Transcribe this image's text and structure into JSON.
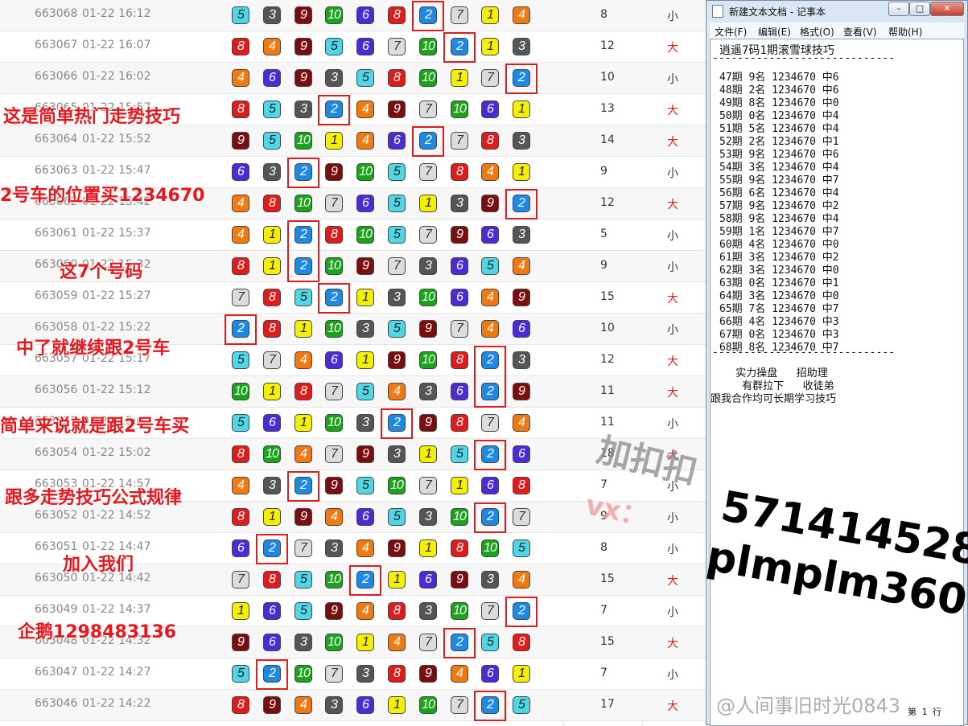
{
  "rows": [
    {
      "issue": "663068",
      "time": "01-22 16:12",
      "balls": [
        5,
        3,
        9,
        10,
        6,
        8,
        2,
        7,
        1,
        4
      ],
      "sum": "8",
      "bs": "小"
    },
    {
      "issue": "663067",
      "time": "01-22 16:07",
      "balls": [
        8,
        4,
        9,
        5,
        6,
        7,
        10,
        2,
        1,
        3
      ],
      "sum": "12",
      "bs": "大"
    },
    {
      "issue": "663066",
      "time": "01-22 16:02",
      "balls": [
        4,
        6,
        9,
        3,
        5,
        8,
        10,
        1,
        7,
        2
      ],
      "sum": "10",
      "bs": "小"
    },
    {
      "issue": "663065",
      "time": "01-22 15:57",
      "balls": [
        8,
        5,
        3,
        2,
        4,
        9,
        7,
        10,
        6,
        1
      ],
      "sum": "13",
      "bs": "大"
    },
    {
      "issue": "663064",
      "time": "01-22 15:52",
      "balls": [
        9,
        5,
        10,
        1,
        4,
        6,
        2,
        7,
        8,
        3
      ],
      "sum": "14",
      "bs": "大"
    },
    {
      "issue": "663063",
      "time": "01-22 15:47",
      "balls": [
        6,
        3,
        2,
        9,
        10,
        5,
        7,
        8,
        4,
        1
      ],
      "sum": "9",
      "bs": "小"
    },
    {
      "issue": "663062",
      "time": "01-22 15:42",
      "balls": [
        4,
        8,
        10,
        7,
        6,
        5,
        1,
        3,
        9,
        2
      ],
      "sum": "12",
      "bs": "大"
    },
    {
      "issue": "663061",
      "time": "01-22 15:37",
      "balls": [
        4,
        1,
        2,
        8,
        10,
        5,
        7,
        9,
        6,
        3
      ],
      "sum": "5",
      "bs": "小"
    },
    {
      "issue": "663060",
      "time": "01-22 15:32",
      "balls": [
        8,
        1,
        2,
        10,
        9,
        7,
        3,
        6,
        5,
        4
      ],
      "sum": "9",
      "bs": "小"
    },
    {
      "issue": "663059",
      "time": "01-22 15:27",
      "balls": [
        7,
        8,
        5,
        2,
        1,
        3,
        10,
        6,
        4,
        9
      ],
      "sum": "15",
      "bs": "大"
    },
    {
      "issue": "663058",
      "time": "01-22 15:22",
      "balls": [
        2,
        8,
        1,
        10,
        3,
        5,
        9,
        7,
        4,
        6
      ],
      "sum": "10",
      "bs": "小"
    },
    {
      "issue": "663057",
      "time": "01-22 15:17",
      "balls": [
        5,
        7,
        4,
        6,
        1,
        9,
        10,
        8,
        2,
        3
      ],
      "sum": "12",
      "bs": "大"
    },
    {
      "issue": "663056",
      "time": "01-22 15:12",
      "balls": [
        10,
        1,
        8,
        7,
        5,
        4,
        3,
        6,
        2,
        9
      ],
      "sum": "11",
      "bs": "大"
    },
    {
      "issue": "663055",
      "time": "01-22 15:07",
      "balls": [
        5,
        6,
        1,
        10,
        3,
        2,
        9,
        8,
        7,
        4
      ],
      "sum": "11",
      "bs": "小"
    },
    {
      "issue": "663054",
      "time": "01-22 15:02",
      "balls": [
        8,
        10,
        4,
        7,
        9,
        3,
        1,
        5,
        2,
        6
      ],
      "sum": "18",
      "bs": "大"
    },
    {
      "issue": "663053",
      "time": "01-22 14:57",
      "balls": [
        4,
        3,
        2,
        9,
        5,
        10,
        7,
        1,
        6,
        8
      ],
      "sum": "7",
      "bs": "小"
    },
    {
      "issue": "663052",
      "time": "01-22 14:52",
      "balls": [
        8,
        1,
        9,
        4,
        6,
        5,
        3,
        10,
        2,
        7
      ],
      "sum": "9",
      "bs": "小"
    },
    {
      "issue": "663051",
      "time": "01-22 14:47",
      "balls": [
        6,
        2,
        7,
        3,
        4,
        9,
        1,
        8,
        10,
        5
      ],
      "sum": "8",
      "bs": "小"
    },
    {
      "issue": "663050",
      "time": "01-22 14:42",
      "balls": [
        7,
        8,
        5,
        10,
        2,
        1,
        6,
        9,
        3,
        4
      ],
      "sum": "15",
      "bs": "大"
    },
    {
      "issue": "663049",
      "time": "01-22 14:37",
      "balls": [
        1,
        6,
        5,
        9,
        4,
        8,
        3,
        10,
        7,
        2
      ],
      "sum": "7",
      "bs": "小"
    },
    {
      "issue": "663048",
      "time": "01-22 14:32",
      "balls": [
        9,
        6,
        3,
        10,
        1,
        4,
        7,
        2,
        5,
        8
      ],
      "sum": "15",
      "bs": "大"
    },
    {
      "issue": "663047",
      "time": "01-22 14:27",
      "balls": [
        5,
        2,
        10,
        7,
        3,
        8,
        9,
        4,
        6,
        1
      ],
      "sum": "7",
      "bs": "小"
    },
    {
      "issue": "663046",
      "time": "01-22 14:22",
      "balls": [
        8,
        9,
        4,
        3,
        6,
        1,
        10,
        7,
        2,
        5
      ],
      "sum": "17",
      "bs": "大"
    }
  ],
  "annotations": [
    "这是简单热门走势技巧",
    "2号车的位置买1234670",
    "这7个号码",
    "中了就继续跟2号车",
    "简单来说就是跟2号车买",
    "跟多走势技巧公式规律",
    "加入我们",
    "企鹅1298483136"
  ],
  "notepad": {
    "title": "新建文本文档 - 记事本",
    "menus": [
      "文件(F)",
      "编辑(E)",
      "格式(O)",
      "查看(V)",
      "帮助(H)"
    ],
    "heading": "逍遥7码1期滚雪球技巧",
    "divider": "-----------------------------",
    "lines": [
      "47期 9名 1234670 中6",
      "48期 2名 1234670 中6",
      "49期 8名 1234670 中0",
      "50期 0名 1234670 中4",
      "51期 5名 1234670 中4",
      "52期 2名 1234670 中1",
      "53期 9名 1234670 中6",
      "54期 3名 1234670 中4",
      "55期 9名 1234670 中7",
      "56期 6名 1234670 中4",
      "57期 9名 1234670 中2",
      "58期 9名 1234670 中4",
      "59期 1名 1234670 中7",
      "60期 4名 1234670 中0",
      "61期 3名 1234670 中2",
      "62期 3名 1234670 中0",
      "63期 0名 1234670 中1",
      "64期 3名 1234670 中0",
      "65期 7名 1234670 中7",
      "66期 4名 1234670 中3",
      "67期 0名 1234670 中3",
      "68期 8名 1234670 中7"
    ],
    "footer1": "    实力操盘   招助理",
    "footer2": "     有群拉下   收徒弟",
    "footer3": "跟我合作均可长期学习技巧",
    "status": "第 1 行"
  },
  "watermark": {
    "line1": "加扣扣",
    "line2": "vx：",
    "number": "571414528",
    "id": "plmplm360",
    "weibo": "@人间事旧时光0843"
  },
  "colors": {
    "1": "#f5ef00",
    "2": "#1e88e5",
    "3": "#555555",
    "4": "#f07a10",
    "5": "#4fd7e8",
    "6": "#4b2bd6",
    "7": "#dcdcdc",
    "8": "#e01b1b",
    "9": "#7a0d0d",
    "10": "#19a519",
    "big": "#e01b1b",
    "small": "#333333",
    "highlight": "#d81e1e",
    "annotation": "#e8171e"
  }
}
